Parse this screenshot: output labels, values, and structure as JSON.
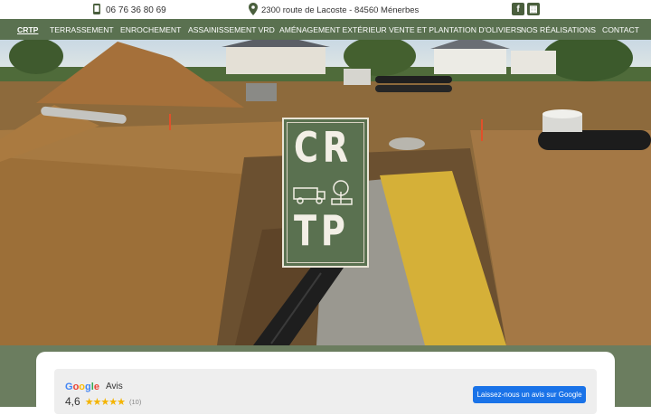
{
  "topbar": {
    "phone": "06 76 36 80 69",
    "address": "2300 route de Lacoste - 84560 Ménerbes",
    "social": [
      {
        "name": "facebook-icon",
        "glyph": "f"
      },
      {
        "name": "gallery-icon",
        "glyph": "▦"
      }
    ]
  },
  "nav": {
    "items": [
      {
        "label": "CRTP",
        "active": true
      },
      {
        "label": "TERRASSEMENT"
      },
      {
        "label": "ENROCHEMENT"
      },
      {
        "label": "ASSAINISSEMENT VRD"
      },
      {
        "label": "AMÉNAGEMENT EXTÉRIEUR"
      },
      {
        "label": "VENTE ET PLANTATION D'OLIVIERS"
      },
      {
        "label": "NOS RÉALISATIONS"
      },
      {
        "label": "CONTACT"
      }
    ]
  },
  "logo": {
    "line1": "CR",
    "line2": "TP"
  },
  "reviews": {
    "google": "Google",
    "avis": "Avis",
    "score": "4,6",
    "stars": "★★★★★",
    "count": "(10)",
    "button": "Laissez-nous un avis sur Google"
  },
  "colors": {
    "brand_green": "#5a7150",
    "google_blue": "#1a73e8",
    "star": "#f4b400"
  }
}
